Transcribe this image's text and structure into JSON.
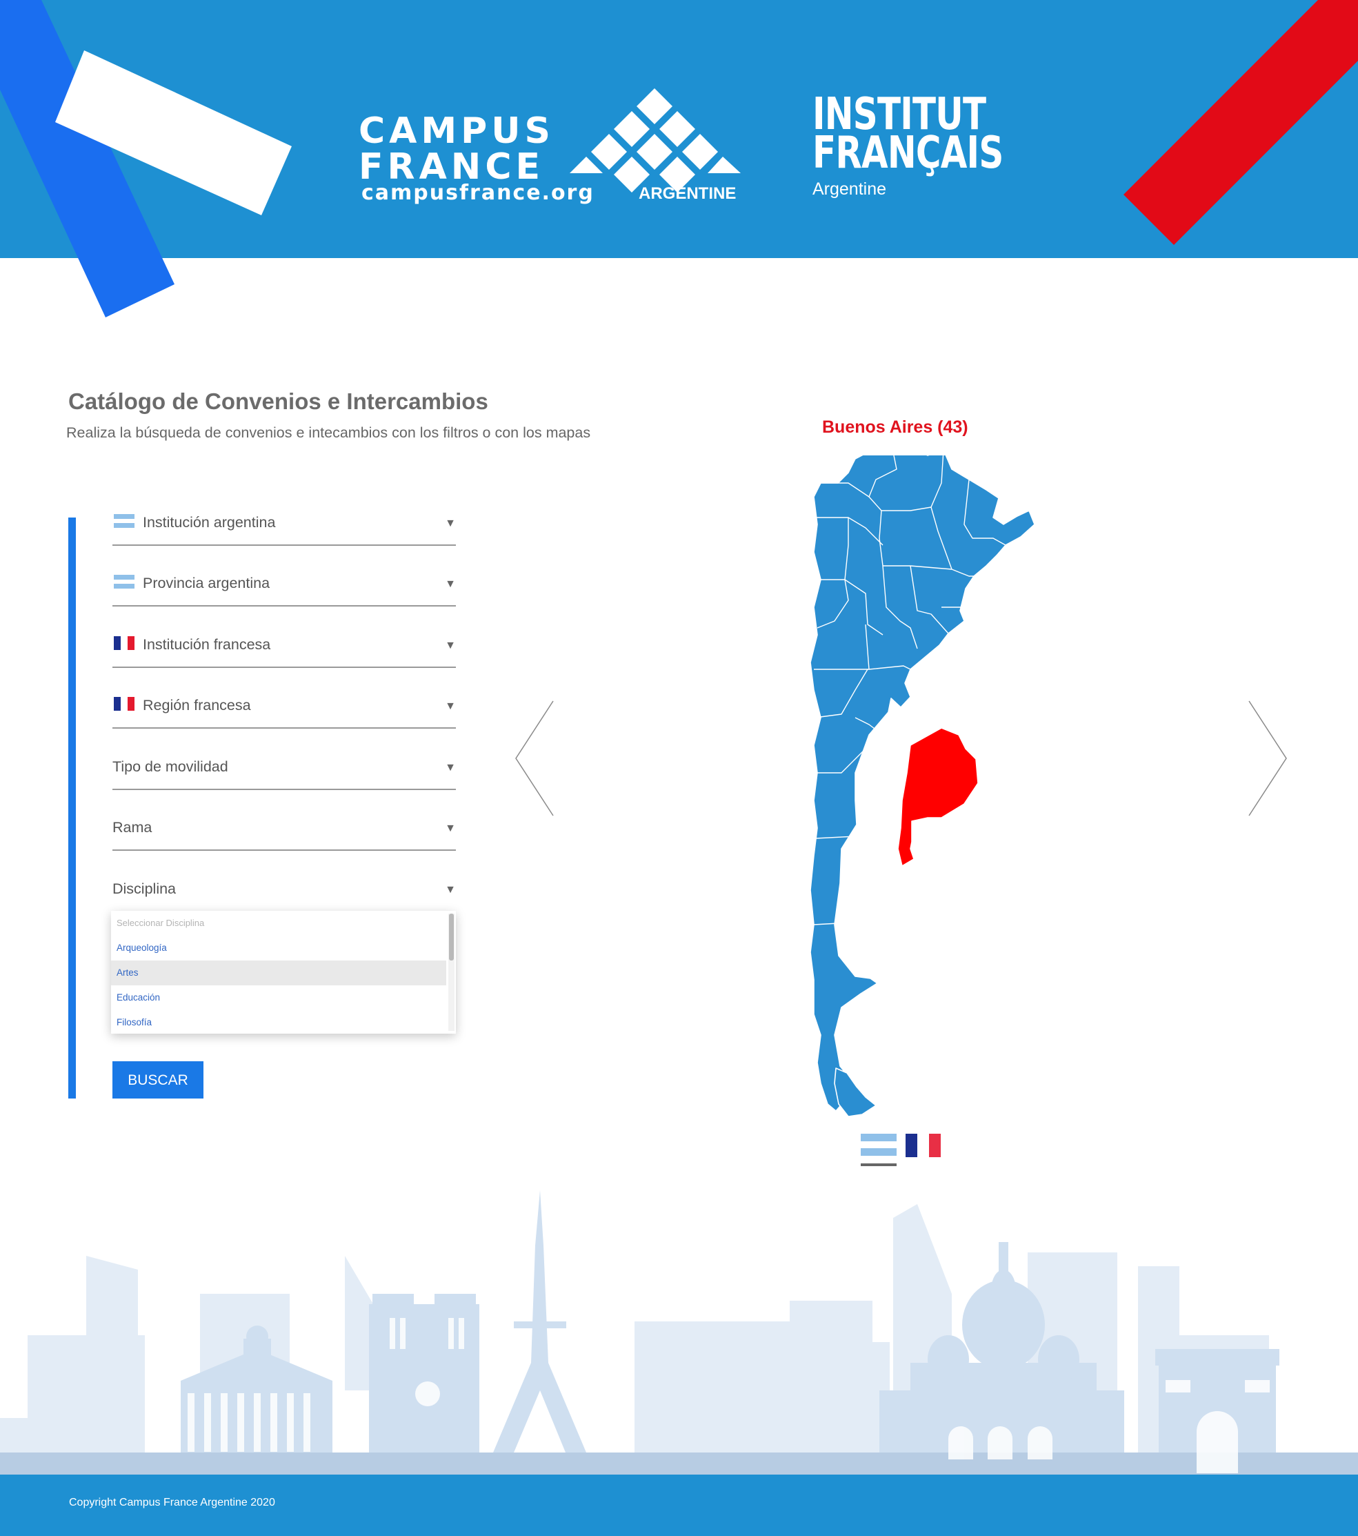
{
  "colors": {
    "brand_blue": "#1e90d2",
    "accent_blue": "#1a79e6",
    "highlight_red": "#ff0000",
    "map_blue": "#2a8ed1"
  },
  "header": {
    "campus_line1": "CAMPUS",
    "campus_line2": "FRANCE",
    "campus_url": "campusfrance.org",
    "campus_country": "ARGENTINE",
    "institut_line1": "INSTITUT",
    "institut_line2": "FRANÇAIS",
    "institut_country": "Argentine"
  },
  "page": {
    "title": "Catálogo de Convenios e Intercambios",
    "subtitle": "Realiza la búsqueda de convenios e intecambios con los filtros o con los mapas"
  },
  "filters": [
    {
      "label": "Institución argentina",
      "flag": "argentina-flag-icon"
    },
    {
      "label": "Provincia argentina",
      "flag": "argentina-flag-icon"
    },
    {
      "label": "Institución francesa",
      "flag": "france-flag-icon"
    },
    {
      "label": "Región francesa",
      "flag": "france-flag-icon"
    },
    {
      "label": "Tipo de movilidad",
      "flag": ""
    },
    {
      "label": "Rama",
      "flag": ""
    },
    {
      "label": "Disciplina",
      "flag": ""
    }
  ],
  "dropdown": {
    "placeholder": "Seleccionar Disciplina",
    "options": [
      "Arqueología",
      "Artes",
      "Educación",
      "Filosofía"
    ],
    "hovered": "Artes"
  },
  "search_button": "BUSCAR",
  "map": {
    "selected_region": "Buenos Aires (43)",
    "tabs": [
      "argentina-flag-icon",
      "france-flag-icon"
    ],
    "active_tab": "argentina-flag-icon"
  },
  "footer": {
    "copyright": "Copyright Campus France Argentine 2020"
  }
}
